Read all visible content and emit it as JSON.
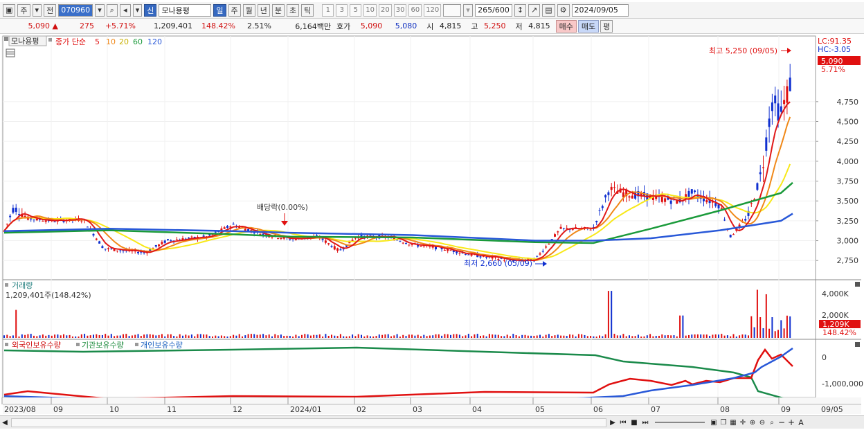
{
  "toolbar": {
    "type_btn": "주",
    "prev_btn": "전",
    "code": "070960",
    "market_badge": "신",
    "stock_name": "모나용평",
    "periods": [
      "일",
      "주",
      "월",
      "년",
      "분",
      "초",
      "틱"
    ],
    "nums": [
      "1",
      "3",
      "5",
      "10",
      "20",
      "30",
      "60",
      "120"
    ],
    "count": "265",
    "count_total": "/600",
    "date": "2024/09/05"
  },
  "info": {
    "price": "5,090",
    "price_arrow": "▲",
    "change": "275",
    "change_pct": "+5.71%",
    "volume": "1,209,401",
    "vol_ratio": "148.42%",
    "turnover": "2.51%",
    "amount": "6,164백만",
    "quote_label": "호가",
    "ask": "5,090",
    "bid": "5,080",
    "open_label": "시",
    "open": "4,815",
    "high_label": "고",
    "high": "5,250",
    "low_label": "저",
    "low": "4,815",
    "buy_btn": "매수",
    "sell_btn": "매도",
    "eval_btn": "평"
  },
  "colors": {
    "up": "#e01010",
    "down": "#1030d0",
    "ma5": "#e01818",
    "ma10": "#f08818",
    "ma20": "#f8e818",
    "ma60": "#1a9a3a",
    "ma120": "#2858d8"
  },
  "chart_data": [
    {
      "type": "candlestick",
      "title": "모나용평",
      "legend": [
        "종가 단순",
        "5",
        "10",
        "20",
        "60",
        "120"
      ],
      "x_labels": [
        "2023/08",
        "09",
        "10",
        "11",
        "12",
        "2024/01",
        "02",
        "03",
        "04",
        "05",
        "06",
        "07",
        "08",
        "09",
        "09/05"
      ],
      "y_ticks": [
        4750,
        4500,
        4250,
        4000,
        3750,
        3500,
        3250,
        3000,
        2750
      ],
      "y_range": [
        2560,
        5420
      ],
      "series": [
        {
          "name": "종가",
          "points": [
            [
              "2023/08",
              3120
            ],
            [
              "2023/08",
              3420
            ],
            [
              "09",
              3280
            ],
            [
              "09",
              3250
            ],
            [
              "10",
              2900
            ],
            [
              "10",
              2850
            ],
            [
              "11",
              3000
            ],
            [
              "11",
              3050
            ],
            [
              "12",
              3200
            ],
            [
              "12",
              3080
            ],
            [
              "2024/01",
              3020
            ],
            [
              "2024/01",
              3050
            ],
            [
              "02",
              2870
            ],
            [
              "02",
              3050
            ],
            [
              "03",
              3050
            ],
            [
              "03",
              2950
            ],
            [
              "04",
              2900
            ],
            [
              "04",
              2820
            ],
            [
              "05",
              2750
            ],
            [
              "05",
              3150
            ],
            [
              "06",
              3650
            ],
            [
              "06",
              3550
            ],
            [
              "07",
              3500
            ],
            [
              "07",
              3600
            ],
            [
              "08",
              3050
            ],
            [
              "08",
              3850
            ],
            [
              "09",
              4750
            ],
            [
              "09/05",
              5090
            ]
          ]
        },
        {
          "name": "120",
          "points": [
            [
              "2023/08",
              3120
            ],
            [
              "10",
              3150
            ],
            [
              "12",
              3120
            ],
            [
              "2024/01",
              3100
            ],
            [
              "03",
              3070
            ],
            [
              "05",
              3000
            ],
            [
              "06",
              3000
            ],
            [
              "07",
              3030
            ],
            [
              "08",
              3130
            ],
            [
              "09",
              3250
            ],
            [
              "09/05",
              3340
            ]
          ]
        },
        {
          "name": "60",
          "points": [
            [
              "2023/08",
              3100
            ],
            [
              "10",
              3130
            ],
            [
              "12",
              3080
            ],
            [
              "2024/01",
              3050
            ],
            [
              "03",
              3040
            ],
            [
              "05",
              2980
            ],
            [
              "06",
              2970
            ],
            [
              "07",
              3150
            ],
            [
              "08",
              3380
            ],
            [
              "09",
              3600
            ],
            [
              "09/05",
              3730
            ]
          ]
        }
      ],
      "annotations": [
        "최고 5,250 (09/05)",
        "최저 2,660 (05/09)",
        "배당락(0.00%)"
      ],
      "right_labels": {
        "lc": "LC:91.35",
        "hc": "HC:-3.05",
        "price": "5,090",
        "pct": "5.71%"
      }
    },
    {
      "type": "bar",
      "title": "거래량",
      "subtitle": "1,209,401주(148.42%)",
      "y_ticks": [
        "4,000K",
        "2,000K"
      ],
      "right_labels": {
        "volume": "1,209K",
        "ratio": "148.42%"
      }
    },
    {
      "type": "line",
      "legend": [
        "외국인보유수량",
        "기관보유수량",
        "개인보유수량"
      ],
      "y_ticks": [
        "0",
        "-1,000,000"
      ]
    }
  ]
}
